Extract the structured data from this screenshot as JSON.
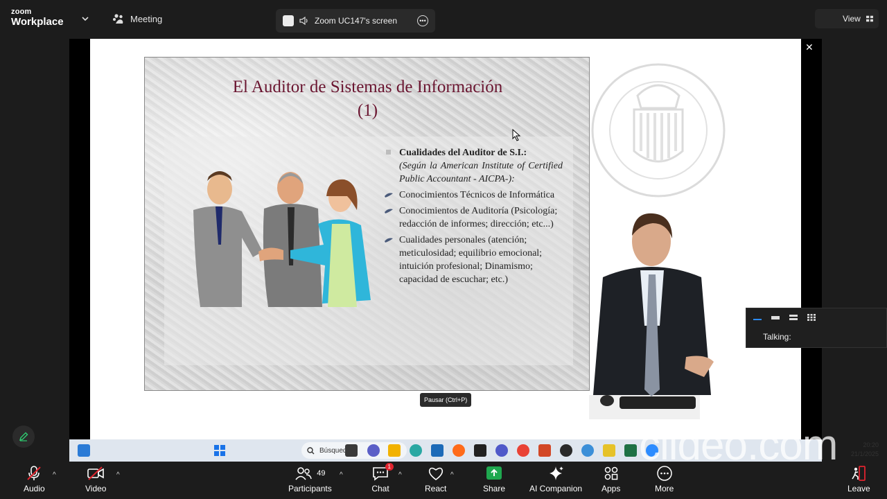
{
  "topbar": {
    "logo_line1": "zoom",
    "logo_line2": "Workplace",
    "meeting_label": "Meeting",
    "screen_label": "Zoom UC147's screen",
    "view_label": "View"
  },
  "slide": {
    "title_line1": "El Auditor de Sistemas de Información",
    "title_line2": "(1)",
    "heading": "Cualidades del Auditor de S.I.:",
    "subheading": "(Según la American Institute of Certified Public Accountant - AICPA-):",
    "bullets": [
      "Conocimientos Técnicos de Informática",
      "Conocimientos de Auditoría (Psicología; redacción de informes; dirección; etc...)",
      "Cualidades personales (atención; meticulosidad; equilibrio emocional; intuición profesional; Dinamismo; capacidad de escuchar; etc.)"
    ]
  },
  "tooltip": "Pausar (Ctrl+P)",
  "taskbar": {
    "search_placeholder": "Búsqueda",
    "time": "20:20",
    "date": "21/1/2025"
  },
  "talk_panel": {
    "label": "Talking:"
  },
  "toolbar": {
    "audio": "Audio",
    "video": "Video",
    "participants": "Participants",
    "participants_count": "49",
    "chat": "Chat",
    "chat_badge": "1",
    "react": "React",
    "share": "Share",
    "ai_companion": "AI Companion",
    "apps": "Apps",
    "more": "More",
    "leave": "Leave"
  },
  "watermark_text": "clideo.com",
  "colors": {
    "share_green": "#1fa84f",
    "shield_green": "#22b14c",
    "slide_title": "#6a1530",
    "leave_red": "#e0242e"
  }
}
